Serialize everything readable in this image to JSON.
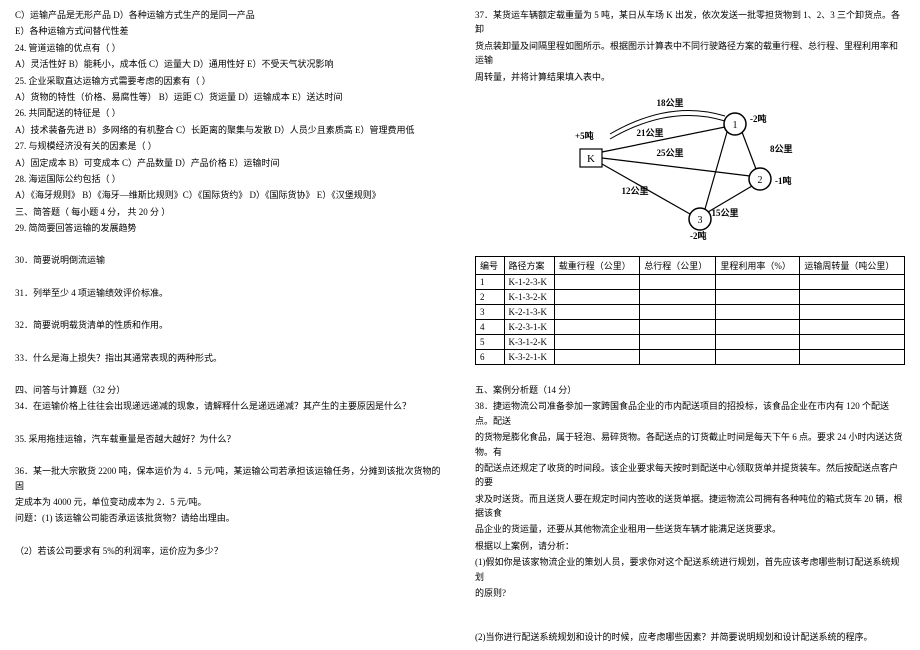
{
  "left": {
    "l1": "C）运输产品是无形产品                   D）各种运输方式生产的是同一产品",
    "l2": "E）各种运输方式间替代性差",
    "l3": "24. 管道运输的优点有（    ）",
    "l4": "A）灵活性好   B）能耗小，成本低    C）运量大     D）通用性好    E）不受天气状况影响",
    "l5": "25. 企业采取直达运输方式需要考虑的因素有（    ）",
    "l6": "A）货物的特性（价格、易腐性等）   B）运距  C）货运量      D）运输成本       E）送达时间",
    "l7": "26. 共同配送的特征是（    ）",
    "l8": "A）技术装备先进 B）多网络的有机整合 C）长距离的聚集与发散    D）人员少且素质高    E）管理费用低",
    "l9": "27. 与规模经济没有关的因素是（    ）",
    "l10": "A）固定成本     B）可变成本    C）产品数量      D）产品价格         E）运输时间",
    "l11": "28. 海运国际公约包括（    ）",
    "l12": "A）《海牙规则》  B）《海牙—维斯比规则》C）《国际货约》       D）《国际货协》     E）《汉堡规则》",
    "l13": "三、简答题（ 每小题 4 分， 共 20 分   ）",
    "l14": "29. 简简要回答运输的发展趋势",
    "l15": "30．简要说明倒流运输",
    "l16": "31．列举至少 4 项运输绩效评价标准。",
    "l17": "32．简要说明载货清单的性质和作用。",
    "l18": "33．什么是海上损失？指出其通常表现的两种形式。",
    "l19": "四、问答与计算题（32 分）",
    "l20": "34．在运输价格上往往会出现递远递减的现象，请解释什么是递远递减？其产生的主要原因是什么？",
    "l21": "35. 采用拖挂运输，汽车载重量是否越大越好？为什么？",
    "l22a": "36．某一批大宗散货 2200 吨，保本运价为 4．5 元/吨，某运输公司若承担该运输任务，分摊到该批次货物的固",
    "l22b": "定成本为 4000 元，单位变动成本为 2．5 元/吨。",
    "l23": "问题：(1) 该运输公司能否承运该批货物？请给出理由。",
    "l24": "（2）若该公司要求有 5%的利润率，运价应为多少？"
  },
  "right": {
    "q37a": "37．某货运车辆额定载重量为 5 吨，某日从车场 K 出发，依次发送一批零担货物到 1、2、3 三个卸货点。各卸",
    "q37b": "货点装卸量及间隔里程如图所示。根据图示计算表中不同行驶路径方案的载重行程、总行程、里程利用率和运输",
    "q37c": "周转量，并将计算结果填入表中。",
    "dia": {
      "k": "K",
      "n1": "1",
      "n2": "2",
      "n3": "3",
      "d18": "18公里",
      "d21": "21公里",
      "d25": "25公里",
      "d12": "12公里",
      "d15": "15公里",
      "d8": "8公里",
      "p5": "+5吨",
      "m2a": "-2吨",
      "m1": "-1吨",
      "m2b": "-2吨"
    },
    "th": {
      "c1": "编号",
      "c2": "路径方案",
      "c3": "载重行程（公里）",
      "c4": "总行程（公里）",
      "c5": "里程利用率（%）",
      "c6": "运输周转量（吨公里）"
    },
    "rows": [
      {
        "n": "1",
        "p": "K-1-2-3-K"
      },
      {
        "n": "2",
        "p": "K-1-3-2-K"
      },
      {
        "n": "3",
        "p": "K-2-1-3-K"
      },
      {
        "n": "4",
        "p": "K-2-3-1-K"
      },
      {
        "n": "5",
        "p": "K-3-1-2-K"
      },
      {
        "n": "6",
        "p": "K-3-2-1-K"
      }
    ],
    "sec5": "五、案例分析题（14 分）",
    "q38a": "38．捷运物流公司准备参加一家跨国食品企业的市内配送项目的招投标，该食品企业在市内有 120 个配送点。配送",
    "q38b": "的货物是膨化食品，属于轻泡、易碎货物。各配送点的订货截止时间是每天下午 6 点。要求 24 小时内送达货物。有",
    "q38c": "的配送点还规定了收货的时间段。该企业要求每天按时到配送中心领取货单并提货装车。然后按配送点客户的要",
    "q38d": "求及时送货。而且送货人要在规定时间内签收的送货单据。捷运物流公司拥有各种吨位的箱式货车 20 辆，根据该食",
    "q38e": "品企业的货运量，还要从其他物流企业租用一些送货车辆才能满足送货要求。",
    "q38f": "根据以上案例，请分析：",
    "q38g": "(1)假如你是该家物流企业的策划人员，要求你对这个配送系统进行规划，首先应该考虑哪些制订配送系统规划",
    "q38h": "的原则?",
    "q38i": "(2)当你进行配送系统规划和设计的时候，应考虑哪些因素？并简要说明规划和设计配送系统的程序。"
  }
}
